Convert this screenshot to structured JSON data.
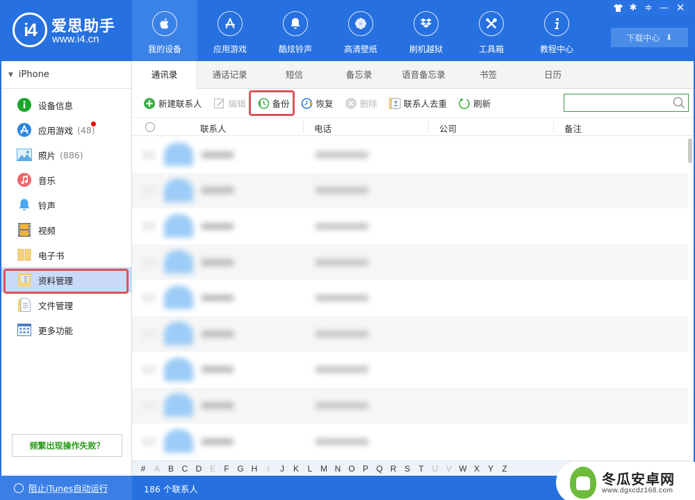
{
  "app": {
    "name": "爱思助手",
    "url": "www.i4.cn",
    "logo_mark": "i4"
  },
  "nav": [
    {
      "label": "我的设备",
      "icon": "apple-icon",
      "active": true
    },
    {
      "label": "应用游戏",
      "icon": "app-store-icon",
      "active": false
    },
    {
      "label": "酷炫铃声",
      "icon": "bell-icon",
      "active": false
    },
    {
      "label": "高清壁纸",
      "icon": "flower-icon",
      "active": false
    },
    {
      "label": "刷机越狱",
      "icon": "dropbox-box-icon",
      "active": false
    },
    {
      "label": "工具箱",
      "icon": "tools-icon",
      "active": false
    },
    {
      "label": "教程中心",
      "icon": "info-icon",
      "active": false
    }
  ],
  "window_controls": {
    "skin": "👕",
    "settings": "✱",
    "menu": "≑",
    "minimize": "—",
    "close": "✕"
  },
  "download_center": {
    "label": "下载中心",
    "icon": "⬇"
  },
  "sidebar": {
    "device_name": "iPhone",
    "items": [
      {
        "label": "设备信息",
        "count": "",
        "icon": "info-circle-icon"
      },
      {
        "label": "应用游戏",
        "count": "(48)",
        "icon": "app-store-icon",
        "badge": true
      },
      {
        "label": "照片",
        "count": "(886)",
        "icon": "photo-icon"
      },
      {
        "label": "音乐",
        "count": "",
        "icon": "music-icon"
      },
      {
        "label": "铃声",
        "count": "",
        "icon": "bell-icon"
      },
      {
        "label": "视频",
        "count": "",
        "icon": "film-icon"
      },
      {
        "label": "电子书",
        "count": "",
        "icon": "book-icon"
      },
      {
        "label": "资料管理",
        "count": "",
        "icon": "contacts-folder-icon",
        "active": true
      },
      {
        "label": "文件管理",
        "count": "",
        "icon": "files-icon"
      },
      {
        "label": "更多功能",
        "count": "",
        "icon": "grid-window-icon"
      }
    ],
    "help_button": "频繁出现操作失败？"
  },
  "tabs": [
    {
      "label": "通讯录",
      "active": true
    },
    {
      "label": "通话记录"
    },
    {
      "label": "短信"
    },
    {
      "label": "备忘录"
    },
    {
      "label": "语音备忘录"
    },
    {
      "label": "书签"
    },
    {
      "label": "日历"
    }
  ],
  "toolbar": {
    "new_contact": "新建联系人",
    "edit": "编辑",
    "backup": "备份",
    "restore": "恢复",
    "delete": "删除",
    "dedupe": "联系人去重",
    "refresh": "刷新",
    "search_placeholder": "",
    "search_value": ""
  },
  "table": {
    "columns": [
      "联系人",
      "电话",
      "公司",
      "备注"
    ],
    "rows": [
      {
        "name": "",
        "phone": ""
      },
      {
        "name": "",
        "phone": ""
      },
      {
        "name": "",
        "phone": ""
      },
      {
        "name": "",
        "phone": ""
      },
      {
        "name": "",
        "phone": ""
      },
      {
        "name": "",
        "phone": ""
      },
      {
        "name": "",
        "phone": ""
      },
      {
        "name": "",
        "phone": ""
      },
      {
        "name": "",
        "phone": ""
      }
    ]
  },
  "alphabet": [
    {
      "l": "#",
      "dim": false
    },
    {
      "l": "A",
      "dim": true
    },
    {
      "l": "B",
      "dim": false
    },
    {
      "l": "C",
      "dim": false
    },
    {
      "l": "D",
      "dim": false
    },
    {
      "l": "E",
      "dim": true
    },
    {
      "l": "F",
      "dim": false
    },
    {
      "l": "G",
      "dim": false
    },
    {
      "l": "H",
      "dim": false
    },
    {
      "l": "I",
      "dim": true
    },
    {
      "l": "J",
      "dim": false
    },
    {
      "l": "K",
      "dim": false
    },
    {
      "l": "L",
      "dim": false
    },
    {
      "l": "M",
      "dim": false
    },
    {
      "l": "N",
      "dim": false
    },
    {
      "l": "O",
      "dim": false
    },
    {
      "l": "P",
      "dim": false
    },
    {
      "l": "Q",
      "dim": false
    },
    {
      "l": "R",
      "dim": false
    },
    {
      "l": "S",
      "dim": false
    },
    {
      "l": "T",
      "dim": false
    },
    {
      "l": "U",
      "dim": true
    },
    {
      "l": "V",
      "dim": true
    },
    {
      "l": "W",
      "dim": false
    },
    {
      "l": "X",
      "dim": false
    },
    {
      "l": "Y",
      "dim": false
    },
    {
      "l": "Z",
      "dim": false
    }
  ],
  "status": {
    "itunes_label": "阻止iTunes自动运行",
    "contact_count": "186 个联系人"
  },
  "watermark": {
    "title": "冬瓜安卓网",
    "url": "www.dgxcdz168.com"
  },
  "colors": {
    "brand_blue": "#2670e0",
    "highlight_red": "#d9535a",
    "active_row": "#c9daf8",
    "help_green": "#2e9a1f"
  }
}
